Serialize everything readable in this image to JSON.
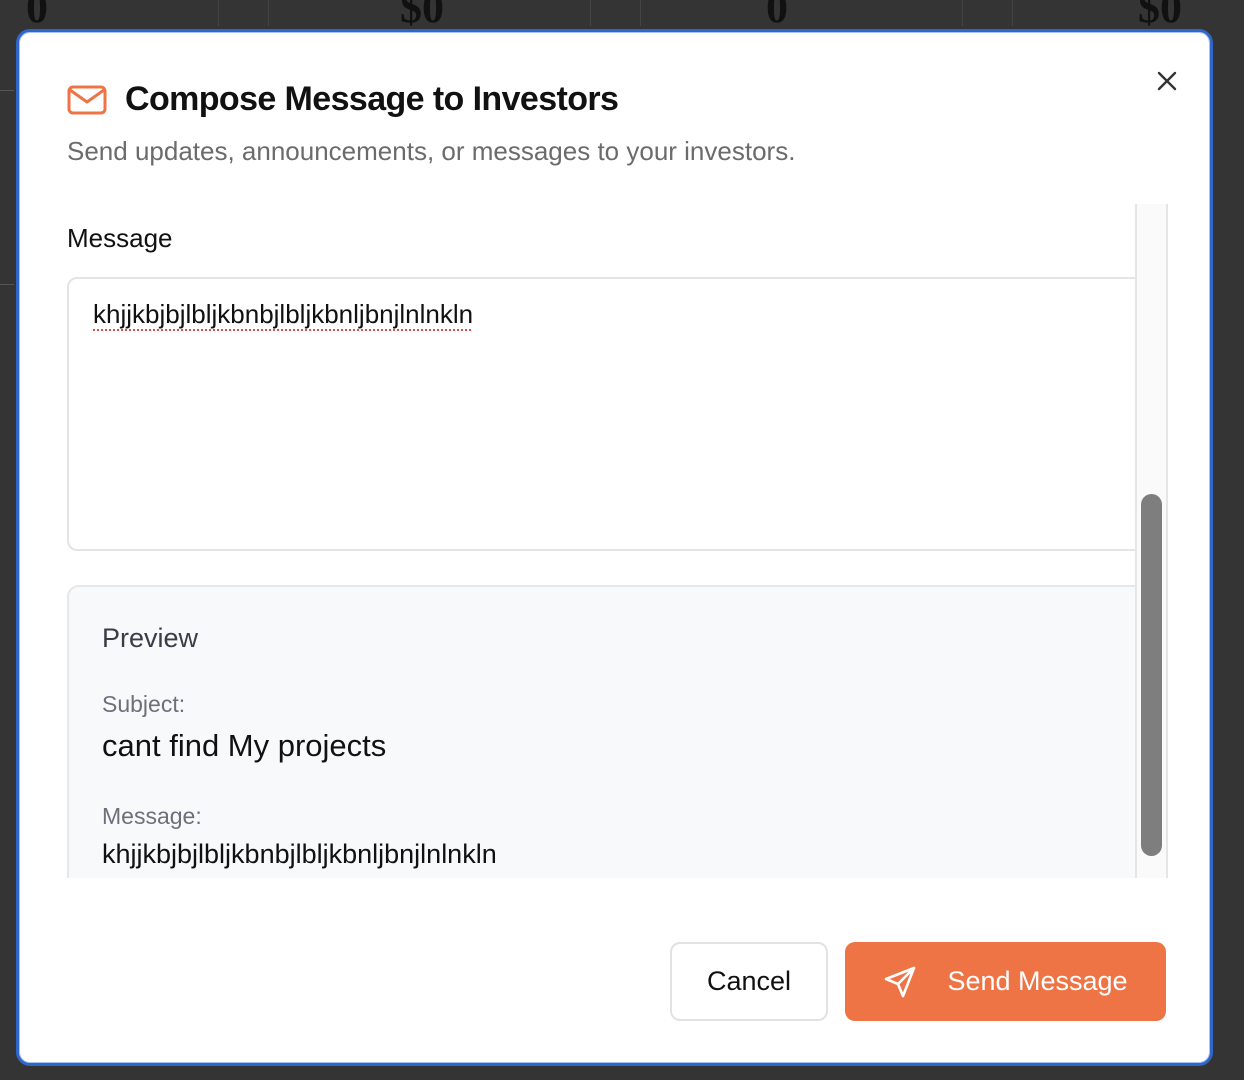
{
  "background": {
    "stats": [
      "0",
      "$0",
      "0",
      "$0"
    ]
  },
  "dialog": {
    "title": "Compose Message to Investors",
    "subtitle": "Send updates, announcements, or messages to your investors.",
    "title_icon": "mail-icon",
    "close_icon": "close-icon"
  },
  "form": {
    "message_label": "Message",
    "message_value": "khjjkbjbjlbljkbnbjlbljkbnljbnjlnlnkln"
  },
  "preview": {
    "title": "Preview",
    "subject_label": "Subject:",
    "subject_value": "cant find My projects",
    "message_label": "Message:",
    "message_value": "khjjkbjbjlbljkbnbjlbljkbnljbnjlnlnkln"
  },
  "footer": {
    "cancel_label": "Cancel",
    "send_label": "Send Message",
    "send_icon": "send-icon"
  },
  "colors": {
    "accent": "#ef7445",
    "focus_border": "#2f66c9",
    "backdrop": "#343434"
  }
}
